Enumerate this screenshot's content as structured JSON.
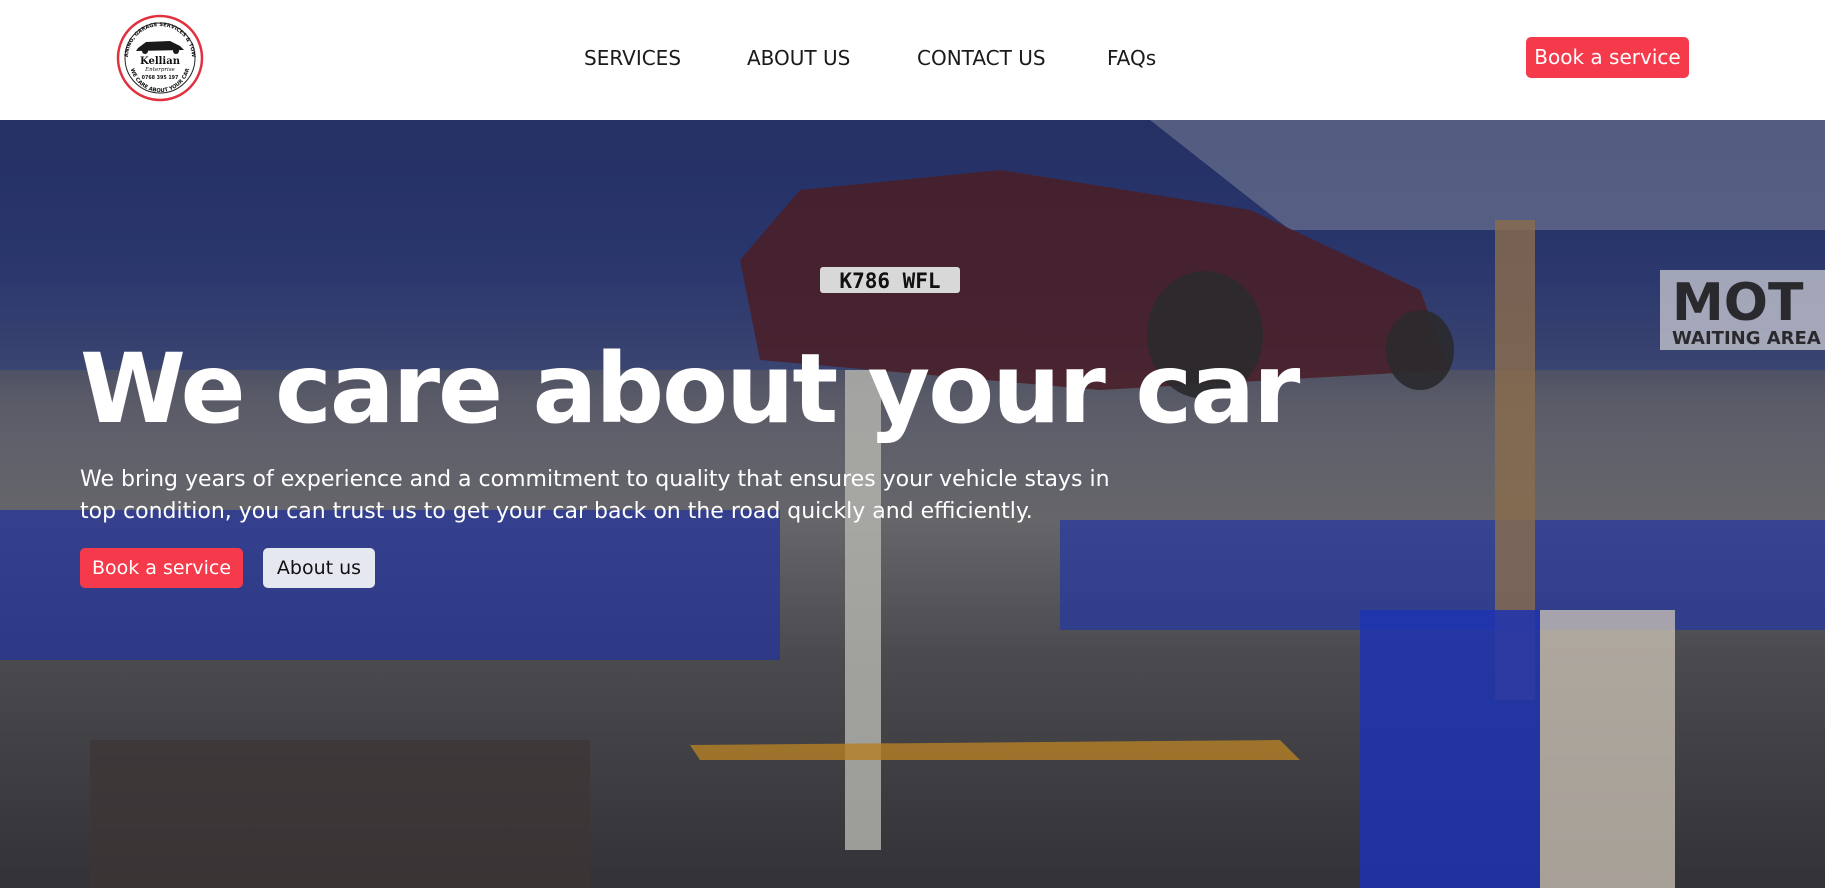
{
  "brand": {
    "logo_ring_top": "CLEANING, GARAGE SERVICES & TOWING",
    "logo_name": "Kellian",
    "logo_sub": "Enterprise",
    "logo_phone": "0768 395 197",
    "logo_ring_bottom": "WE CARE ABOUT YOUR CAR"
  },
  "nav": {
    "links": [
      {
        "label": "SERVICES"
      },
      {
        "label": "ABOUT US"
      },
      {
        "label": "CONTACT US"
      },
      {
        "label": "FAQs"
      }
    ],
    "cta_label": "Book a service"
  },
  "hero": {
    "title": "We care about your car",
    "subtitle": "We bring years of experience and a commitment to quality that ensures your vehicle stays in top condition, you can trust us to get your car back on the road quickly and efficiently.",
    "primary_button": "Book a service",
    "secondary_button": "About us"
  },
  "background_photo": {
    "plate": "K786 WFL",
    "sign_text": "MOT",
    "sign_sub": "WAITING AREA"
  },
  "colors": {
    "accent": "#f43a4b",
    "secondary_button": "#e5e8f0",
    "nav_background": "#ffffff"
  },
  "icons": {
    "logo": "car-badge-logo"
  }
}
